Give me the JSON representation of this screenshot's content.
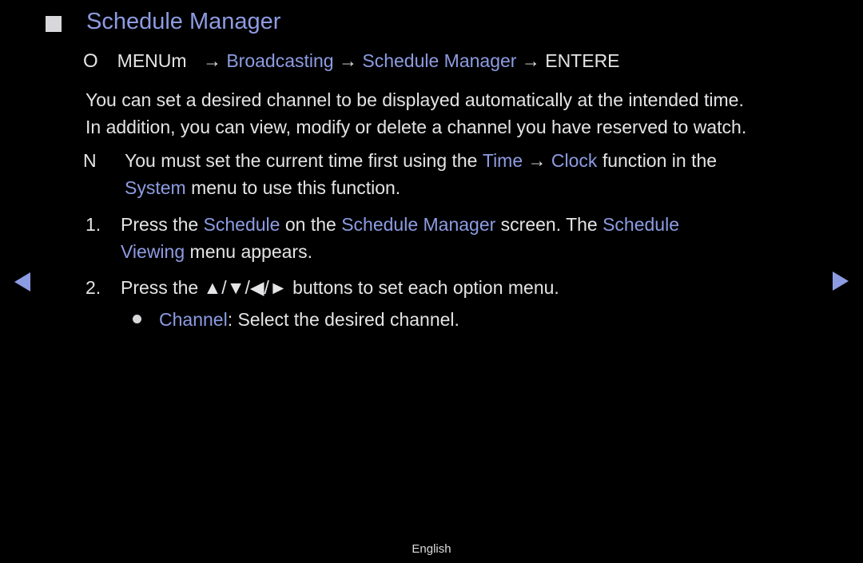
{
  "header": {
    "title": "Schedule Manager",
    "title_marker_icon": "square-bullet-icon"
  },
  "menu_path": {
    "prefix_icon": "O",
    "menu_label": "MENUm",
    "arrow": "→",
    "items": [
      "Broadcasting",
      "Schedule Manager"
    ],
    "enter_label": "ENTERE"
  },
  "intro": {
    "line1": "You can set a desired channel to be displayed automatically at the intended time.",
    "line2": "In addition, you can view, modify or delete a channel you have reserved to watch."
  },
  "note": {
    "marker": "N",
    "line1_pre": "You must set the current time first using the ",
    "time": "Time",
    "arrow": " → ",
    "clock": "Clock",
    "line1_post": " function in the",
    "system": "System",
    "line2_post": " menu to use this function."
  },
  "steps": [
    {
      "number": "1.",
      "pre": "Press the ",
      "schedule": "Schedule",
      "mid": " on the ",
      "schedule_manager": "Schedule Manager",
      "post": " screen. The ",
      "schedule2": "Schedule",
      "viewing": "Viewing",
      "line2_post": " menu appears."
    },
    {
      "number": "2.",
      "text": "Press the ▲/▼/◀/► buttons to set each option menu."
    }
  ],
  "bullets": [
    {
      "label": "Channel",
      "text": ": Select the desired channel."
    }
  ],
  "navigation": {
    "prev_icon": "left-triangle-icon",
    "next_icon": "right-triangle-icon"
  },
  "footer": {
    "language": "English"
  },
  "colors": {
    "accent": "#8d9ce2",
    "text": "#e4e4e6",
    "background": "#000000"
  }
}
